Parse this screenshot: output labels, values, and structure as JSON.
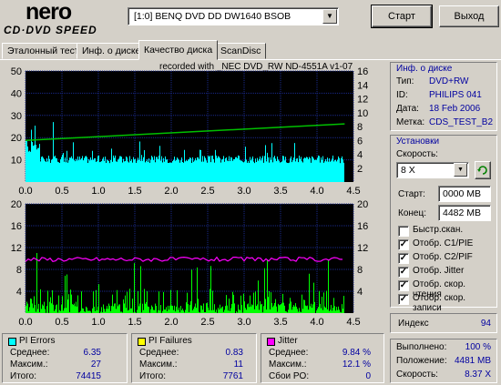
{
  "header": {
    "logo_main": "nero",
    "logo_sub": "CD·DVD SPEED",
    "drive": "[1:0]  BENQ DVD DD DW1640 BSOB",
    "start_label": "Старт",
    "exit_label": "Выход"
  },
  "tabs": [
    {
      "label": "Эталонный тест"
    },
    {
      "label": "Инф. о диске"
    },
    {
      "label": "Качество диска",
      "active": true
    },
    {
      "label": "ScanDisc"
    }
  ],
  "chart_title": "recorded with _NEC    DVD_RW ND-4551A  v1-07",
  "chart_data": [
    {
      "type": "area",
      "name": "PI Errors / read speed",
      "x_ticks": [
        "0.0",
        "0.5",
        "1.0",
        "1.5",
        "2.0",
        "2.5",
        "3.0",
        "3.5",
        "4.0",
        "4.5"
      ],
      "y_left_ticks": [
        "50",
        "40",
        "30",
        "20",
        "10"
      ],
      "y_right_ticks": [
        "16",
        "14",
        "12",
        "10",
        "8",
        "6",
        "4",
        "2"
      ],
      "xlim": [
        0,
        4.5
      ],
      "ylim_left": [
        0,
        50
      ],
      "ylim_right": [
        0,
        16
      ],
      "speed_line": {
        "start": 6.0,
        "end": 8.37
      },
      "pi_avg": 6.35,
      "pi_max": 27,
      "colors": {
        "bars": "#00ffff",
        "speed": "#00c000",
        "background": "#000000"
      }
    },
    {
      "type": "area",
      "name": "PI Failures / jitter",
      "x_ticks": [
        "0.0",
        "0.5",
        "1.0",
        "1.5",
        "2.0",
        "2.5",
        "3.0",
        "3.5",
        "4.0",
        "4.5"
      ],
      "y_left_ticks": [
        "20",
        "16",
        "12",
        "8",
        "4"
      ],
      "y_right_ticks": [
        "20",
        "16",
        "12",
        "8",
        "4"
      ],
      "xlim": [
        0,
        4.5
      ],
      "ylim_left": [
        0,
        20
      ],
      "ylim_right": [
        0,
        20
      ],
      "jitter_level": 9.84,
      "colors": {
        "bars": "#00ff00",
        "jitter": "#ff00ff",
        "background": "#000000"
      }
    }
  ],
  "disc_info": {
    "title": "Инф. о диске",
    "rows": [
      {
        "label": "Тип:",
        "value": "DVD+RW"
      },
      {
        "label": "ID:",
        "value": "PHILIPS 041"
      },
      {
        "label": "Дата:",
        "value": "18 Feb 2006"
      },
      {
        "label": "Метка:",
        "value": "CDS_TEST_B2"
      }
    ]
  },
  "settings": {
    "title": "Установки",
    "speed_label": "Скорость:",
    "speed_value": "8 X",
    "start_label": "Старт:",
    "start_value": "0000 MB",
    "end_label": "Конец:",
    "end_value": "4482 MB",
    "checkboxes": [
      {
        "label": "Быстр.скан.",
        "checked": false
      },
      {
        "label": "Отобр. C1/PIE",
        "checked": true
      },
      {
        "label": "Отобр. C2/PIF",
        "checked": true
      },
      {
        "label": "Отобр. Jitter",
        "checked": true
      },
      {
        "label": "Отобр. скор. чтения",
        "checked": true
      },
      {
        "label": "Отобр. скор. записи",
        "checked": true
      }
    ]
  },
  "index": {
    "label": "Индекс",
    "value": "94"
  },
  "progress": {
    "rows": [
      {
        "label": "Выполнено:",
        "value": "100 %"
      },
      {
        "label": "Положение:",
        "value": "4481 MB"
      },
      {
        "label": "Скорость:",
        "value": "8.37 X"
      }
    ]
  },
  "stats": {
    "pi_errors": {
      "title": "PI Errors",
      "color": "#00ffff",
      "rows": [
        {
          "label": "Среднее:",
          "value": "6.35"
        },
        {
          "label": "Максим.:",
          "value": "27"
        },
        {
          "label": "Итого:",
          "value": "74415"
        }
      ]
    },
    "pi_failures": {
      "title": "PI Failures",
      "color": "#ffff00",
      "rows": [
        {
          "label": "Среднее:",
          "value": "0.83"
        },
        {
          "label": "Максим.:",
          "value": "11"
        },
        {
          "label": "Итого:",
          "value": "7761"
        }
      ]
    },
    "jitter": {
      "title": "Jitter",
      "color": "#ff00ff",
      "rows": [
        {
          "label": "Среднее:",
          "value": "9.84 %"
        },
        {
          "label": "Максим.:",
          "value": "12.1 %"
        },
        {
          "label": "Сбои PO:",
          "value": "0"
        }
      ]
    }
  }
}
